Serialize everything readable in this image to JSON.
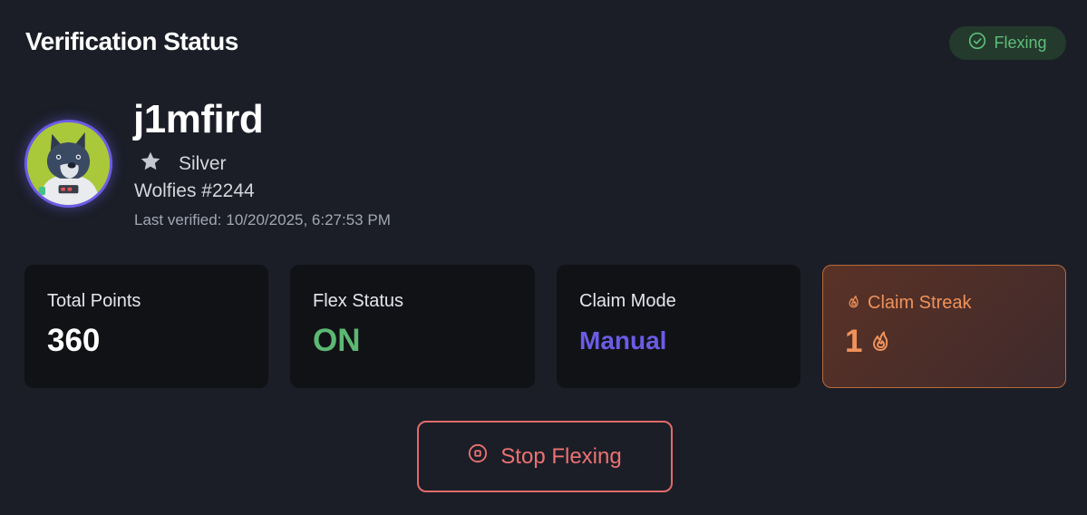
{
  "header": {
    "title": "Verification Status",
    "status_badge": {
      "label": "Flexing",
      "icon": "check-circle-icon",
      "color": "#5fbd7a"
    }
  },
  "profile": {
    "avatar_icon": "wolf-avatar",
    "username": "j1mfird",
    "tier": {
      "label": "Silver",
      "icon": "star-icon"
    },
    "collection": "Wolfies #2244",
    "last_verified_label": "Last verified:",
    "last_verified_value": "10/20/2025, 6:27:53 PM"
  },
  "stats": {
    "total_points": {
      "label": "Total Points",
      "value": "360"
    },
    "flex_status": {
      "label": "Flex Status",
      "value": "ON",
      "color": "#5cb873"
    },
    "claim_mode": {
      "label": "Claim Mode",
      "value": "Manual",
      "color": "#6b5ce6"
    },
    "claim_streak": {
      "label": "Claim Streak",
      "value": "1",
      "icon": "flame-icon",
      "color": "#f0925b"
    }
  },
  "actions": {
    "stop_button": {
      "label": "Stop Flexing",
      "icon": "stop-circle-icon",
      "color": "#ec7272"
    }
  }
}
